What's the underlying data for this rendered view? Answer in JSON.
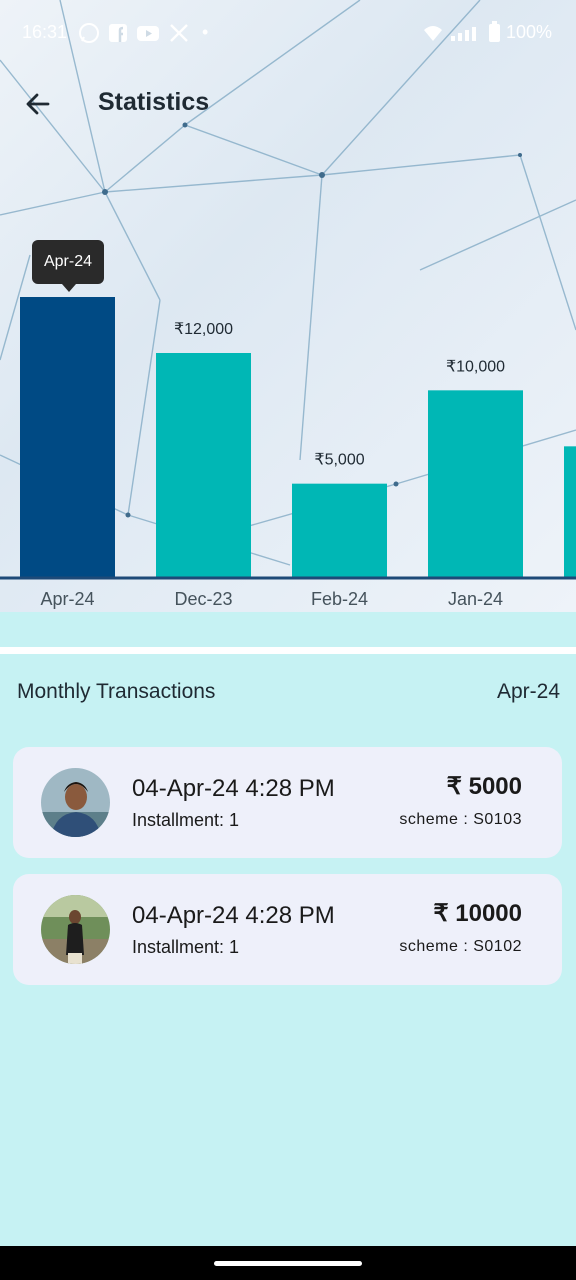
{
  "status_bar": {
    "time": "16:31",
    "app_icons": [
      "whatsapp-icon",
      "facebook-icon",
      "youtube-icon",
      "x-icon"
    ],
    "battery": "100%"
  },
  "app_bar": {
    "title": "Statistics"
  },
  "chart_data": {
    "type": "bar",
    "categories": [
      "Apr-24",
      "Dec-23",
      "Feb-24",
      "Jan-24"
    ],
    "values": [
      15000,
      12000,
      5000,
      10000
    ],
    "data_labels": [
      "",
      "₹12,000",
      "₹5,000",
      "₹10,000"
    ],
    "partial_bar_value": 7000,
    "selected": "Apr-24",
    "tooltip": "Apr-24",
    "colors": {
      "selected": "#004a84",
      "default": "#00b7b5",
      "axis": "#1d4a78"
    }
  },
  "transactions": {
    "title": "Monthly Transactions",
    "month": "Apr-24",
    "items": [
      {
        "datetime": "04-Apr-24 4:28 PM",
        "installment": "Installment: 1",
        "amount": "₹ 5000",
        "scheme": "scheme : S0103"
      },
      {
        "datetime": "04-Apr-24 4:28 PM",
        "installment": "Installment: 1",
        "amount": "₹ 10000",
        "scheme": "scheme : S0102"
      }
    ]
  },
  "colors": {
    "page_bg": "#c6f2f3",
    "card_bg": "#eef0fa"
  }
}
